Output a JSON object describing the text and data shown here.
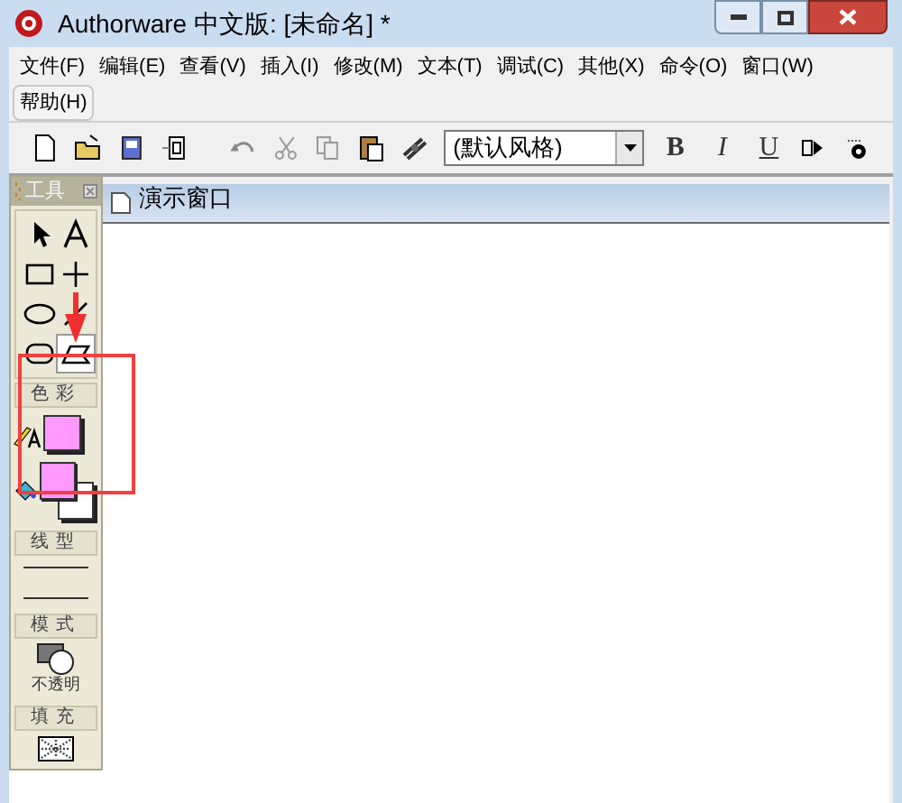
{
  "window": {
    "title": "Authorware 中文版: [未命名] *"
  },
  "menu": [
    {
      "label": "文件(F)",
      "selected": false
    },
    {
      "label": "编辑(E)",
      "selected": false
    },
    {
      "label": "查看(V)",
      "selected": false
    },
    {
      "label": "插入(I)",
      "selected": false
    },
    {
      "label": "修改(M)",
      "selected": false
    },
    {
      "label": "文本(T)",
      "selected": false
    },
    {
      "label": "调试(C)",
      "selected": false
    },
    {
      "label": "其他(X)",
      "selected": false
    },
    {
      "label": "命令(O)",
      "selected": false
    },
    {
      "label": "窗口(W)",
      "selected": false
    },
    {
      "label": "帮助(H)",
      "selected": true
    }
  ],
  "toolbar": {
    "style_dropdown": {
      "value": "(默认风格)"
    },
    "format_buttons": [
      "B",
      "I",
      "U"
    ]
  },
  "presentation_window": {
    "title": "演示窗口"
  },
  "tools_palette": {
    "title": "工具",
    "tools": [
      {
        "kind": "pointer",
        "selected": false
      },
      {
        "kind": "text",
        "selected": false
      },
      {
        "kind": "rectangle",
        "selected": false
      },
      {
        "kind": "cross",
        "selected": false
      },
      {
        "kind": "ellipse",
        "selected": false
      },
      {
        "kind": "line",
        "selected": false
      },
      {
        "kind": "rounded",
        "selected": false
      },
      {
        "kind": "polygon",
        "selected": true
      }
    ],
    "sections": [
      {
        "kind": "color",
        "label": "色彩"
      },
      {
        "kind": "line_style",
        "label": "线型"
      },
      {
        "kind": "mode",
        "label": "模式",
        "caption": "不透明"
      },
      {
        "kind": "fill",
        "label": "填充"
      }
    ]
  }
}
